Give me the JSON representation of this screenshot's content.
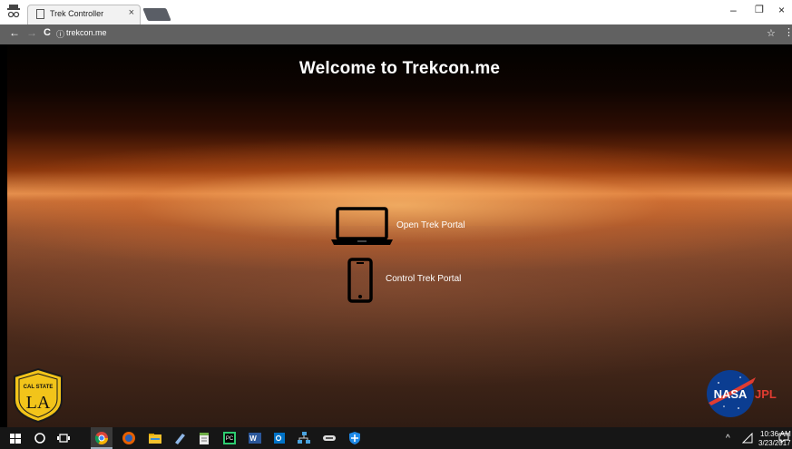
{
  "browser": {
    "tab_title": "Trek Controller",
    "tab_close": "×",
    "url": "trekcon.me",
    "back": "←",
    "forward": "→",
    "reload": "C",
    "info": "ⓘ",
    "star": "☆",
    "menu": "⋮",
    "minimize": "–",
    "restore": "❐",
    "close": "×"
  },
  "page": {
    "title": "Welcome to Trekcon.me",
    "open_portal_label": "Open Trek Portal",
    "control_portal_label": "Control Trek Portal",
    "logo_left_top": "CAL STATE",
    "logo_left_main": "LA",
    "logo_right_main": "NASA",
    "logo_right_sub": "JPL"
  },
  "taskbar": {
    "tray_chevron": "^",
    "time": "10:36 AM",
    "date": "3/23/2017"
  },
  "colors": {
    "accent_gold": "#f2c41a",
    "nasa_blue": "#0b3d91",
    "jpl_red": "#e03c31"
  }
}
